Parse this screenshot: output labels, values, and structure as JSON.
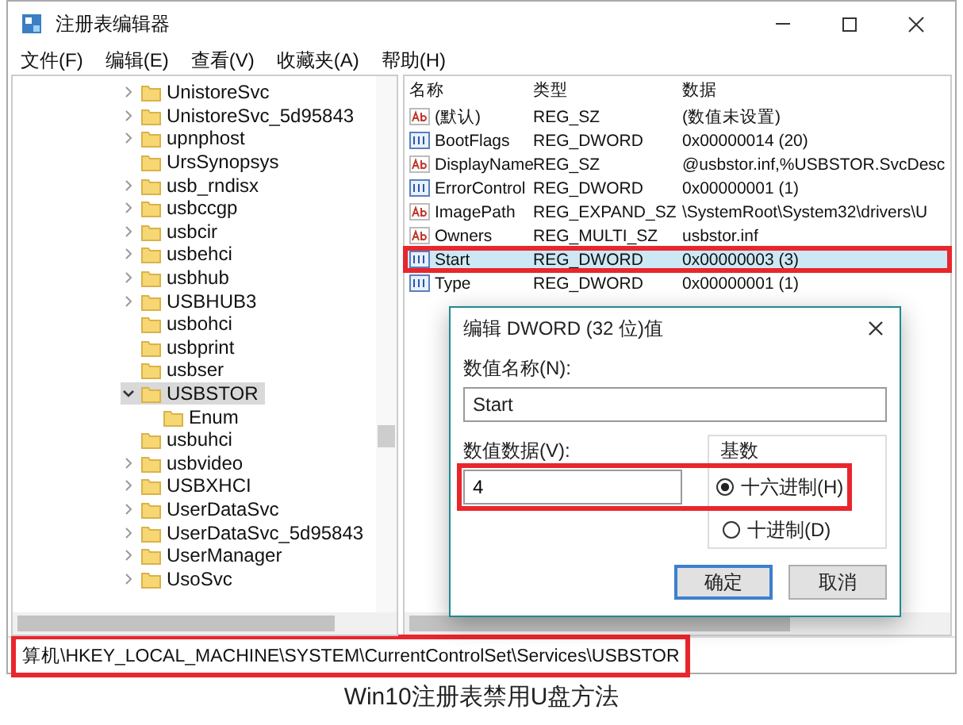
{
  "window": {
    "title": "注册表编辑器"
  },
  "menu": [
    "文件(F)",
    "编辑(E)",
    "查看(V)",
    "收藏夹(A)",
    "帮助(H)"
  ],
  "tree": {
    "items": [
      {
        "label": "UnistoreSvc",
        "expandable": true,
        "selected": false
      },
      {
        "label": "UnistoreSvc_5d95843",
        "expandable": true,
        "selected": false
      },
      {
        "label": "upnphost",
        "expandable": true,
        "selected": false
      },
      {
        "label": "UrsSynopsys",
        "expandable": false,
        "selected": false
      },
      {
        "label": "usb_rndisx",
        "expandable": true,
        "selected": false
      },
      {
        "label": "usbccgp",
        "expandable": true,
        "selected": false
      },
      {
        "label": "usbcir",
        "expandable": true,
        "selected": false
      },
      {
        "label": "usbehci",
        "expandable": true,
        "selected": false
      },
      {
        "label": "usbhub",
        "expandable": true,
        "selected": false
      },
      {
        "label": "USBHUB3",
        "expandable": true,
        "selected": false
      },
      {
        "label": "usbohci",
        "expandable": false,
        "selected": false
      },
      {
        "label": "usbprint",
        "expandable": false,
        "selected": false
      },
      {
        "label": "usbser",
        "expandable": false,
        "selected": false
      },
      {
        "label": "USBSTOR",
        "expandable": true,
        "expanded": true,
        "selected": true,
        "children": [
          {
            "label": "Enum",
            "expandable": false,
            "selected": false
          }
        ]
      },
      {
        "label": "usbuhci",
        "expandable": false,
        "selected": false
      },
      {
        "label": "usbvideo",
        "expandable": true,
        "selected": false
      },
      {
        "label": "USBXHCI",
        "expandable": true,
        "selected": false
      },
      {
        "label": "UserDataSvc",
        "expandable": true,
        "selected": false
      },
      {
        "label": "UserDataSvc_5d95843",
        "expandable": true,
        "selected": false
      },
      {
        "label": "UserManager",
        "expandable": true,
        "selected": false
      },
      {
        "label": "UsoSvc",
        "expandable": true,
        "selected": false
      }
    ]
  },
  "values": {
    "columns": [
      "名称",
      "类型",
      "数据"
    ],
    "rows": [
      {
        "kind": "string",
        "name": "(默认)",
        "type": "REG_SZ",
        "data": "(数值未设置)",
        "selected": false,
        "highlighted": false
      },
      {
        "kind": "number",
        "name": "BootFlags",
        "type": "REG_DWORD",
        "data": "0x00000014 (20)",
        "selected": false,
        "highlighted": false
      },
      {
        "kind": "string",
        "name": "DisplayName",
        "type": "REG_SZ",
        "data": "@usbstor.inf,%USBSTOR.SvcDesc",
        "selected": false,
        "highlighted": false
      },
      {
        "kind": "number",
        "name": "ErrorControl",
        "type": "REG_DWORD",
        "data": "0x00000001 (1)",
        "selected": false,
        "highlighted": false
      },
      {
        "kind": "string",
        "name": "ImagePath",
        "type": "REG_EXPAND_SZ",
        "data": "\\SystemRoot\\System32\\drivers\\U",
        "selected": false,
        "highlighted": false
      },
      {
        "kind": "string",
        "name": "Owners",
        "type": "REG_MULTI_SZ",
        "data": "usbstor.inf",
        "selected": false,
        "highlighted": false
      },
      {
        "kind": "number",
        "name": "Start",
        "type": "REG_DWORD",
        "data": "0x00000003 (3)",
        "selected": true,
        "highlighted": true
      },
      {
        "kind": "number",
        "name": "Type",
        "type": "REG_DWORD",
        "data": "0x00000001 (1)",
        "selected": false,
        "highlighted": false
      }
    ]
  },
  "dialog": {
    "title": "编辑 DWORD (32 位)值",
    "name_label": "数值名称(N):",
    "name_value": "Start",
    "data_label": "数值数据(V):",
    "data_value": "4",
    "radix_label": "基数",
    "highlighted": true,
    "radios": [
      {
        "label": "十六进制(H)",
        "selected": true
      },
      {
        "label": "十进制(D)",
        "selected": false
      }
    ],
    "buttons": [
      {
        "label": "确定",
        "default": true
      },
      {
        "label": "取消",
        "default": false
      }
    ]
  },
  "status_bar": {
    "path": "算机\\HKEY_LOCAL_MACHINE\\SYSTEM\\CurrentControlSet\\Services\\USBSTOR",
    "highlighted": true
  },
  "caption": "Win10注册表禁用U盘方法"
}
